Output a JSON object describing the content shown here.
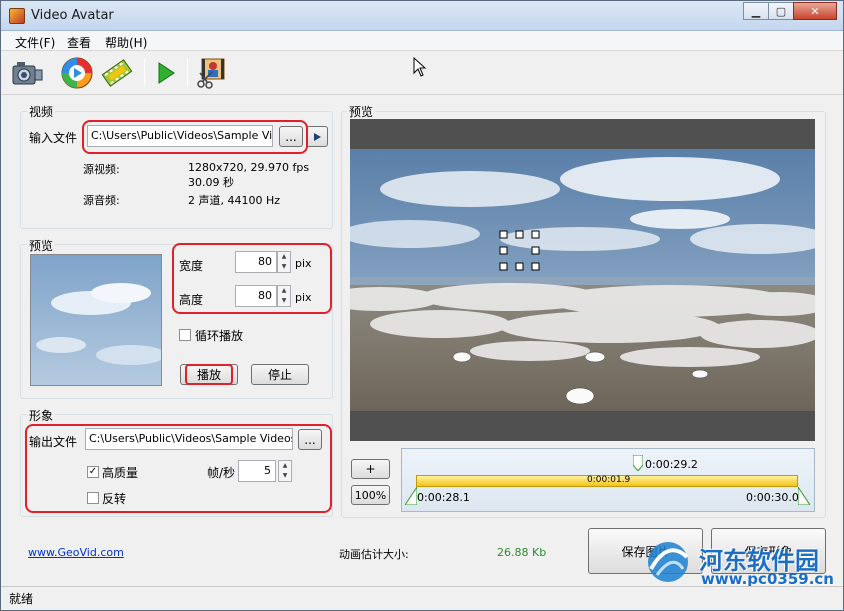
{
  "window": {
    "title": "Video Avatar"
  },
  "menu": [
    "文件(F)",
    "查看",
    "帮助(H)"
  ],
  "toolbar": {
    "icons": [
      "camera-icon",
      "media-player-icon",
      "film-icon",
      "play-icon",
      "video-cut-icon"
    ]
  },
  "video_group": {
    "label": "视频",
    "input_label": "输入文件",
    "input_value": "C:\\Users\\Public\\Videos\\Sample Videos\\",
    "browse_label": "...",
    "source_video_label": "源视频:",
    "source_video_value": "1280x720, 29.970 fps",
    "source_duration": "30.09 秒",
    "source_audio_label": "源音频:",
    "source_audio_value": "2 声道, 44100 Hz"
  },
  "preview_group": {
    "label": "预览",
    "width_label": "宽度",
    "width_value": "80",
    "width_unit": "pix",
    "height_label": "高度",
    "height_value": "80",
    "height_unit": "pix",
    "loop_label": "循环播放",
    "play_label": "播放",
    "stop_label": "停止"
  },
  "avatar_group": {
    "label": "形象",
    "output_label": "输出文件",
    "output_value": "C:\\Users\\Public\\Videos\\Sample Videos\\Wild",
    "browse_label": "...",
    "hq_label": "高质量",
    "hq_checked": "✓",
    "fps_label": "帧/秒",
    "fps_value": "5",
    "flip_label": "反转"
  },
  "main_preview": {
    "label": "预览"
  },
  "timeline": {
    "zoom_in": "+",
    "zoom_level": "100%",
    "marker_time": "0:00:29.2",
    "duration": "0:00:01.9",
    "start_time": "0:00:28.1",
    "end_time": "0:00:30.0"
  },
  "footer": {
    "website": "www.GeoVid.com",
    "size_label": "动画估计大小:",
    "size_value": "26.88 Kb",
    "save_image": "保存图片",
    "save_avatar": "保存形象"
  },
  "watermark": {
    "line1": "河东软件园",
    "line2": "www.pc0359.cn"
  },
  "status": {
    "text": "就绪"
  },
  "colors": {
    "highlight": "#e0202a",
    "size_value": "#2e8b2e",
    "link": "#0033cc"
  }
}
